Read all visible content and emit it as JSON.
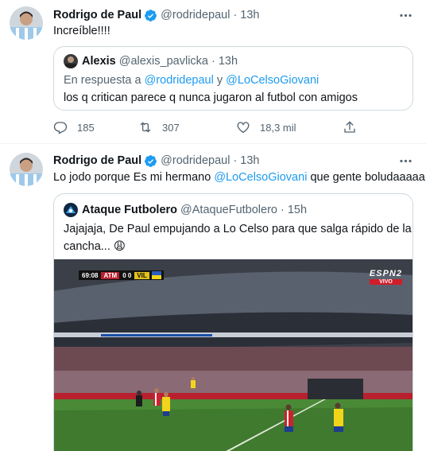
{
  "tweets": [
    {
      "author_name": "Rodrigo de Paul",
      "author_handle": "@rodridepaul",
      "time": "13h",
      "separator": "·",
      "text": "Increíble!!!!",
      "quote": {
        "author_name": "Alexis",
        "author_handle": "@alexis_pavlicka",
        "time": "13h",
        "separator": "·",
        "reply_prefix": "En respuesta a ",
        "reply_user1": "@rodridepaul",
        "reply_and": " y ",
        "reply_user2": "@LoCelsoGiovani",
        "text": "los q critican parece q nunca jugaron al futbol con amigos"
      },
      "actions": {
        "replies": "185",
        "retweets": "307",
        "likes": "18,3 mil"
      }
    },
    {
      "author_name": "Rodrigo de Paul",
      "author_handle": "@rodridepaul",
      "time": "13h",
      "separator": "·",
      "text_before": "Lo jodo porque Es mi hermano ",
      "mention": "@LoCelsoGiovani",
      "text_after": " que gente boludaaaaa 🤦‍♂️",
      "quote": {
        "author_name": "Ataque Futbolero",
        "author_handle": "@AtaqueFutbolero",
        "time": "15h",
        "separator": "·",
        "line1": "Jajajaja, De Paul empujando a Lo Celso para que salga rápido de la",
        "line2": "cancha... 😩",
        "video": {
          "clock": "69:08",
          "home": "ATM",
          "score": "0 0",
          "away": "VIL",
          "network": "ESPN2",
          "live": "VIVO"
        }
      }
    }
  ],
  "colors": {
    "verified": "#1d9bf0",
    "link": "#1d9bf0",
    "muted": "#536471",
    "border": "#cfd9de"
  }
}
